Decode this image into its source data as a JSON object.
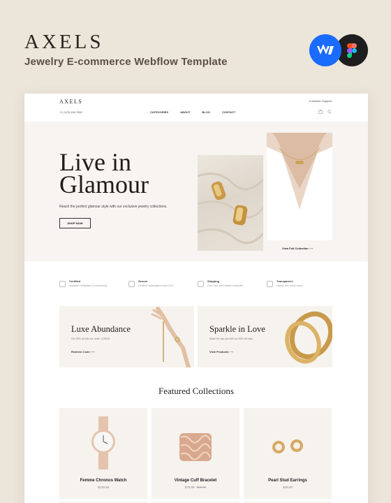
{
  "brand": "AXELS",
  "subtitle": "Jewelry E-commerce Webflow Template",
  "badges": [
    {
      "name": "webflow-icon",
      "glyph": "W",
      "color": "#1a6bff"
    },
    {
      "name": "figma-icon",
      "color": "#1e1e1e"
    }
  ],
  "site": {
    "logo": "AXELS",
    "support": "Customer Support",
    "phone": "+1 (123) 456 7890",
    "menu": [
      "CATEGORIES",
      "ABOUT",
      "BLOG",
      "CONTACT"
    ],
    "icons": [
      "cart-icon",
      "search-icon"
    ]
  },
  "hero": {
    "title_line1": "Live in",
    "title_line2": "Glamour",
    "text": "Reach the perfect glamour style with our exclusive jewelry collections.",
    "button": "SHOP NOW",
    "link": "View Full Collection"
  },
  "features": [
    {
      "title": "Certified",
      "desc": "Available certificates of authenticity",
      "icon": "certificate-icon"
    },
    {
      "title": "Secure",
      "desc": "Certified marketplace since 2017",
      "icon": "lock-icon"
    },
    {
      "title": "Shipping",
      "desc": "Free, fast, and reliable worldwide",
      "icon": "truck-icon"
    },
    {
      "title": "Transparent",
      "desc": "Hassle-free return policy",
      "icon": "return-icon"
    }
  ],
  "promos": [
    {
      "title": "Luxe Abundance",
      "text": "Get 30% off with our code: LUXE30",
      "link": "Redeem Code"
    },
    {
      "title": "Sparkle in Love",
      "text": "Make her say yes with our 50% off rings",
      "link": "View Products"
    }
  ],
  "featured": {
    "title": "Featured Collections",
    "products": [
      {
        "name": "Femme Chronos Watch",
        "price": "$139.99",
        "old_price": ""
      },
      {
        "name": "Vintage Cuff Bracelet",
        "price": "$79.99",
        "old_price": "$99.99"
      },
      {
        "name": "Pearl Stud Earrings",
        "price": "$49.99",
        "old_price": ""
      }
    ]
  },
  "colors": {
    "background": "#ece5d9",
    "hero": "#f7f4f1",
    "gold": "#c9a35a",
    "webflow": "#1a6bff"
  }
}
